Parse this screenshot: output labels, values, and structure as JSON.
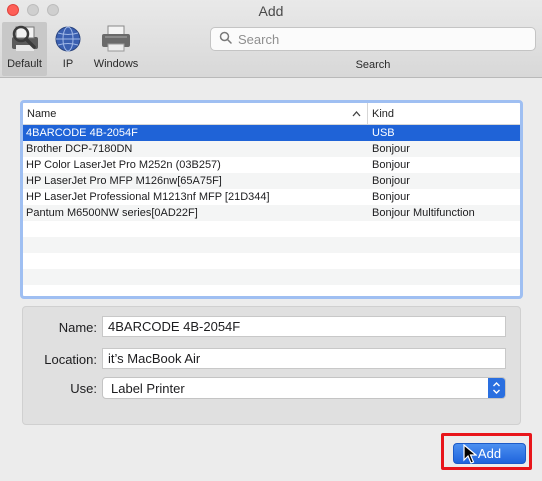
{
  "window": {
    "title": "Add"
  },
  "toolbar": {
    "tools": [
      {
        "label": "Default",
        "icon": "default-printer-icon",
        "selected": true
      },
      {
        "label": "IP",
        "icon": "globe-icon",
        "selected": false
      },
      {
        "label": "Windows",
        "icon": "windows-printer-icon",
        "selected": false
      }
    ],
    "search": {
      "placeholder": "Search",
      "value": "",
      "label": "Search"
    }
  },
  "table": {
    "columns": {
      "name": "Name",
      "kind": "Kind"
    },
    "rows": [
      {
        "name": "4BARCODE 4B-2054F",
        "kind": "USB",
        "selected": true
      },
      {
        "name": "Brother DCP-7180DN",
        "kind": "Bonjour"
      },
      {
        "name": "HP Color LaserJet Pro M252n (03B257)",
        "kind": "Bonjour"
      },
      {
        "name": "HP LaserJet Pro MFP M126nw[65A75F]",
        "kind": "Bonjour"
      },
      {
        "name": "HP LaserJet Professional M1213nf MFP [21D344]",
        "kind": "Bonjour"
      },
      {
        "name": "Pantum M6500NW series[0AD22F]",
        "kind": "Bonjour Multifunction"
      }
    ]
  },
  "form": {
    "name_label": "Name:",
    "name_value": "4BARCODE 4B-2054F",
    "location_label": "Location:",
    "location_value": "it’s MacBook Air",
    "use_label": "Use:",
    "use_value": "Label Printer"
  },
  "actions": {
    "add_label": "Add"
  },
  "colors": {
    "accent": "#1f63d7",
    "highlight": "#e8151a",
    "close": "#fe5f57"
  }
}
